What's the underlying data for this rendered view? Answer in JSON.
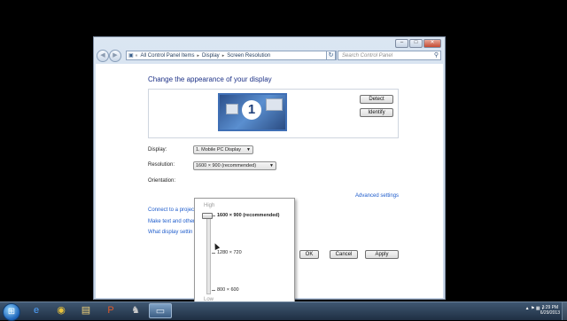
{
  "address": {
    "crumbs": [
      "All Control Panel Items",
      "Display",
      "Screen Resolution"
    ]
  },
  "search": {
    "placeholder": "Search Control Panel"
  },
  "page": {
    "title": "Change the appearance of your display",
    "detect_label": "Detect",
    "identify_label": "Identify",
    "monitor_number": "1"
  },
  "fields": {
    "display_label": "Display:",
    "display_value": "1. Mobile PC Display",
    "resolution_label": "Resolution:",
    "resolution_value": "1600 × 900 (recommended)",
    "orientation_label": "Orientation:"
  },
  "links": {
    "advanced": "Advanced settings",
    "projector": "Connect to a projec",
    "text_size": "Make text and other",
    "display_settings": "What display settin"
  },
  "buttons": {
    "ok": "OK",
    "cancel": "Cancel",
    "apply": "Apply"
  },
  "dropdown": {
    "high_label": "High",
    "low_label": "Low",
    "options": [
      "1600 × 900 (recommended)",
      "1280 × 720",
      "800 × 600"
    ],
    "selected_index": 0
  },
  "taskbar": {
    "time": "3:29 PM",
    "date": "6/29/2013",
    "items": [
      "start-orb",
      "ie",
      "chrome",
      "explorer",
      "powerpoint",
      "game",
      "display-settings"
    ]
  }
}
